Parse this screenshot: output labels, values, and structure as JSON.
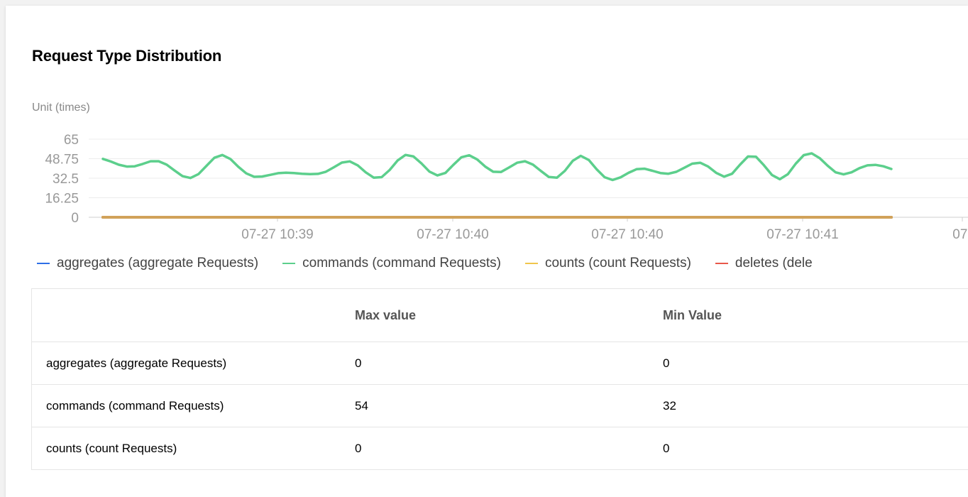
{
  "panel": {
    "title": "Request Type Distribution",
    "unit_label": "Unit (times)"
  },
  "chart_data": {
    "type": "line",
    "y_ticks": [
      "65",
      "48.75",
      "32.5",
      "16.25",
      "0"
    ],
    "ylim": [
      0,
      65
    ],
    "x_ticks": [
      "07-27 10:39",
      "07-27 10:40",
      "07-27 10:40",
      "07-27 10:41",
      "07-"
    ],
    "grid": true,
    "legend_position": "bottom",
    "series": [
      {
        "name": "aggregates (aggregate Requests)",
        "color": "#2e6fe6",
        "values": [
          0,
          0,
          0,
          0,
          0,
          0,
          0,
          0,
          0,
          0,
          0,
          0,
          0,
          0,
          0,
          0,
          0,
          0,
          0,
          0,
          0,
          0,
          0,
          0,
          0,
          0,
          0,
          0,
          0,
          0,
          0,
          0,
          0,
          0,
          0,
          0,
          0,
          0,
          0,
          0,
          0,
          0,
          0,
          0,
          0,
          0,
          0,
          0,
          0,
          0,
          0,
          0,
          0,
          0,
          0,
          0,
          0,
          0,
          0,
          0,
          0,
          0,
          0,
          0,
          0,
          0,
          0,
          0,
          0,
          0,
          0,
          0,
          0,
          0,
          0,
          0,
          0,
          0,
          0,
          0,
          0,
          0,
          0,
          0,
          0,
          0,
          0,
          0,
          0,
          0,
          0,
          0,
          0,
          0,
          0,
          0,
          0,
          0,
          0,
          0
        ]
      },
      {
        "name": "commands (command Requests)",
        "color": "#5ccf8c",
        "values": [
          48.6,
          46.4,
          43.7,
          42.2,
          42.4,
          44.4,
          46.6,
          46.6,
          43.8,
          38.9,
          34.2,
          32.7,
          35.9,
          42.8,
          49.5,
          51.8,
          48.5,
          42.0,
          36.5,
          33.7,
          33.9,
          35.3,
          36.7,
          37.1,
          36.8,
          36.2,
          35.9,
          36.1,
          37.9,
          41.6,
          45.5,
          46.5,
          43.2,
          37.4,
          33.0,
          33.4,
          39.3,
          47.2,
          51.9,
          50.6,
          44.8,
          38.0,
          34.8,
          36.9,
          43.6,
          49.9,
          51.6,
          48.1,
          42.2,
          37.9,
          37.7,
          41.4,
          45.4,
          46.6,
          43.8,
          38.5,
          33.5,
          32.9,
          38.6,
          47.0,
          51.1,
          47.7,
          39.9,
          33.3,
          31.0,
          33.2,
          37.0,
          40.0,
          40.4,
          38.7,
          36.8,
          36.2,
          37.8,
          41.2,
          44.6,
          45.4,
          42.2,
          37.0,
          33.8,
          36.2,
          43.8,
          50.6,
          50.4,
          43.3,
          35.2,
          31.7,
          35.8,
          44.6,
          51.7,
          53.2,
          49.2,
          42.9,
          37.4,
          35.7,
          37.4,
          40.9,
          43.2,
          43.6,
          42.4,
          40.2
        ]
      },
      {
        "name": "counts (count Requests)",
        "color": "#f0c54c",
        "values": [
          0,
          0,
          0,
          0,
          0,
          0,
          0,
          0,
          0,
          0,
          0,
          0,
          0,
          0,
          0,
          0,
          0,
          0,
          0,
          0,
          0,
          0,
          0,
          0,
          0,
          0,
          0,
          0,
          0,
          0,
          0,
          0,
          0,
          0,
          0,
          0,
          0,
          0,
          0,
          0,
          0,
          0,
          0,
          0,
          0,
          0,
          0,
          0,
          0,
          0,
          0,
          0,
          0,
          0,
          0,
          0,
          0,
          0,
          0,
          0,
          0,
          0,
          0,
          0,
          0,
          0,
          0,
          0,
          0,
          0,
          0,
          0,
          0,
          0,
          0,
          0,
          0,
          0,
          0,
          0,
          0,
          0,
          0,
          0,
          0,
          0,
          0,
          0,
          0,
          0,
          0,
          0,
          0,
          0,
          0,
          0,
          0,
          0,
          0,
          0
        ]
      },
      {
        "name": "deletes (dele",
        "color": "#e8584a",
        "values": [
          0,
          0,
          0,
          0,
          0,
          0,
          0,
          0,
          0,
          0,
          0,
          0,
          0,
          0,
          0,
          0,
          0,
          0,
          0,
          0,
          0,
          0,
          0,
          0,
          0,
          0,
          0,
          0,
          0,
          0,
          0,
          0,
          0,
          0,
          0,
          0,
          0,
          0,
          0,
          0,
          0,
          0,
          0,
          0,
          0,
          0,
          0,
          0,
          0,
          0,
          0,
          0,
          0,
          0,
          0,
          0,
          0,
          0,
          0,
          0,
          0,
          0,
          0,
          0,
          0,
          0,
          0,
          0,
          0,
          0,
          0,
          0,
          0,
          0,
          0,
          0,
          0,
          0,
          0,
          0,
          0,
          0,
          0,
          0,
          0,
          0,
          0,
          0,
          0,
          0,
          0,
          0,
          0,
          0,
          0,
          0,
          0,
          0,
          0,
          0
        ]
      }
    ],
    "zero_line_color": "#d1a25a"
  },
  "legend": [
    {
      "label": "aggregates (aggregate Requests)",
      "color": "#2e6fe6"
    },
    {
      "label": "commands (command Requests)",
      "color": "#5ccf8c"
    },
    {
      "label": "counts (count Requests)",
      "color": "#f0c54c"
    },
    {
      "label": "deletes (dele",
      "color": "#e8584a"
    }
  ],
  "table": {
    "headers": [
      "",
      "Max value",
      "Min Value"
    ],
    "rows": [
      {
        "name": "aggregates (aggregate Requests)",
        "max": "0",
        "min": "0"
      },
      {
        "name": "commands (command Requests)",
        "max": "54",
        "min": "32"
      },
      {
        "name": "counts (count Requests)",
        "max": "0",
        "min": "0"
      }
    ]
  }
}
